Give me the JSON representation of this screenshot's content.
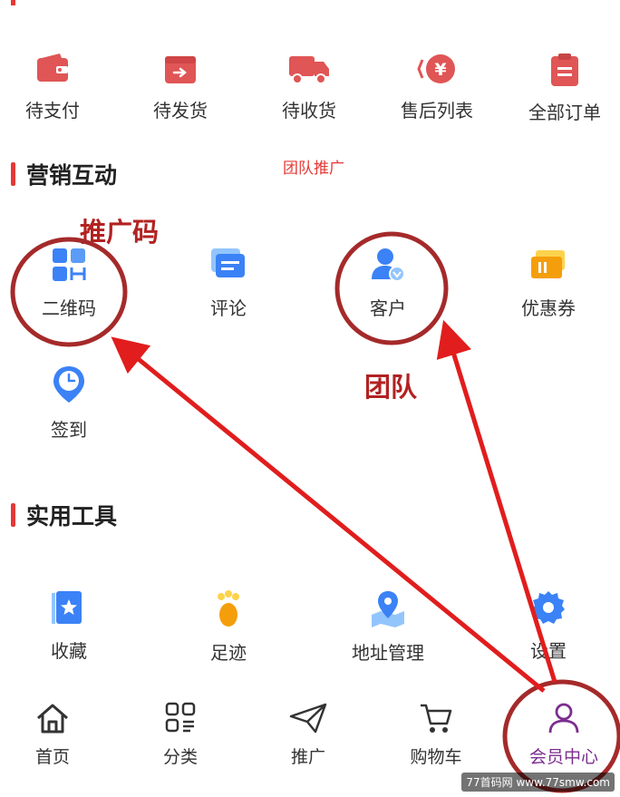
{
  "orders": {
    "items": [
      {
        "label": "待支付",
        "icon": "wallet-icon"
      },
      {
        "label": "待发货",
        "icon": "box-icon"
      },
      {
        "label": "待收货",
        "icon": "truck-icon"
      },
      {
        "label": "售后列表",
        "icon": "yen-refund-icon"
      },
      {
        "label": "全部订单",
        "icon": "clipboard-icon"
      }
    ]
  },
  "marketing": {
    "title": "营销互动",
    "note": "团队推广",
    "items": [
      {
        "label": "二维码",
        "icon": "qrcode-icon"
      },
      {
        "label": "评论",
        "icon": "comment-icon"
      },
      {
        "label": "客户",
        "icon": "customer-icon"
      },
      {
        "label": "优惠券",
        "icon": "coupon-icon"
      },
      {
        "label": "签到",
        "icon": "clock-pin-icon"
      }
    ]
  },
  "annotations": {
    "qrcode_note": "推广码",
    "customer_note": "团队"
  },
  "tools": {
    "title": "实用工具",
    "items": [
      {
        "label": "收藏",
        "icon": "star-bookmark-icon"
      },
      {
        "label": "足迹",
        "icon": "footprint-icon"
      },
      {
        "label": "地址管理",
        "icon": "map-pin-icon"
      },
      {
        "label": "设置",
        "icon": "gear-icon"
      }
    ]
  },
  "nav": {
    "items": [
      {
        "label": "首页",
        "icon": "home-icon"
      },
      {
        "label": "分类",
        "icon": "category-icon"
      },
      {
        "label": "推广",
        "icon": "paper-plane-icon"
      },
      {
        "label": "购物车",
        "icon": "cart-icon"
      },
      {
        "label": "会员中心",
        "icon": "user-icon",
        "active": true
      }
    ]
  },
  "watermark": "77首码网 www.77smw.com",
  "colors": {
    "order_icon": "#e05555",
    "accent_red": "#e53935",
    "annotation_red": "#b22222",
    "icon_blue": "#3b82f6",
    "nav_active": "#7b2d8e"
  }
}
